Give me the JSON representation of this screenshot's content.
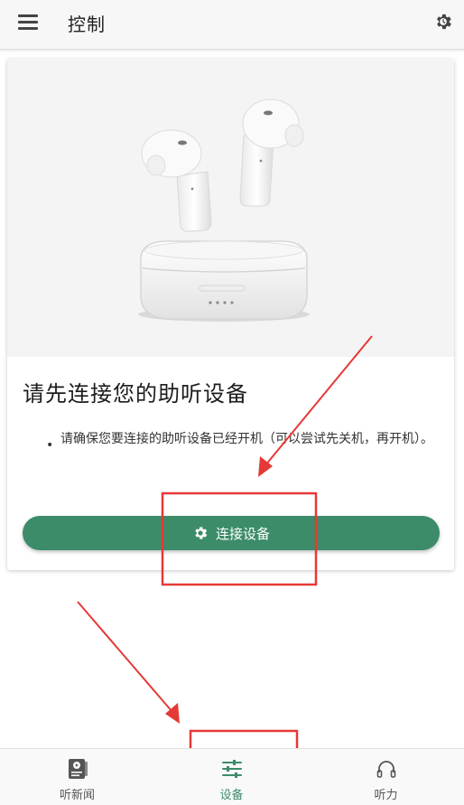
{
  "appbar": {
    "title": "控制",
    "menu_icon": "hamburger-menu-icon",
    "settings_icon": "gear-icon"
  },
  "card": {
    "image_alt": "earbuds-with-charging-case",
    "heading": "请先连接您的助听设备",
    "bullets": [
      "请确保您要连接的助听设备已经开机（可以尝试先关机，再开机）。"
    ],
    "connect_button": "连接设备",
    "connect_icon": "gear-icon"
  },
  "bottom_nav": {
    "items": [
      {
        "label": "听新闻",
        "icon": "news-player-icon",
        "active": false
      },
      {
        "label": "设备",
        "icon": "sliders-icon",
        "active": true
      },
      {
        "label": "听力",
        "icon": "headphones-icon",
        "active": false
      }
    ]
  },
  "colors": {
    "accent": "#3c8c6a",
    "annotation": "#e53935"
  }
}
